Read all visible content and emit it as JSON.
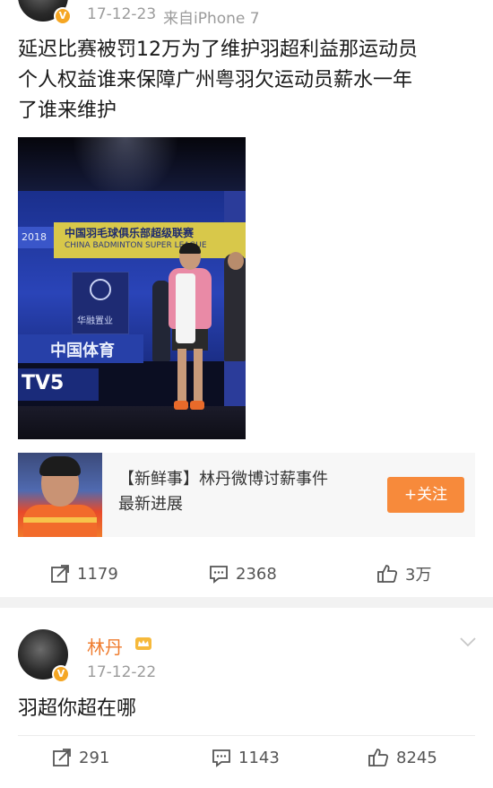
{
  "post1": {
    "timestamp": "17-12-23",
    "source": "来自iPhone 7",
    "text_lines": [
      "延迟比赛被罚12万为了维护羽超利益那运动员",
      "个人权益谁来保障广州粤羽欠运动员薪水一年",
      "了谁来维护"
    ],
    "photo": {
      "banner_cn": "中国羽毛球俱乐部超级联赛",
      "banner_en": "CHINA BADMINTON SUPER LEAGUE",
      "year": "2018",
      "sign": "中国体育",
      "logo_text": "华融置业",
      "tv_text": "TV5"
    },
    "news": {
      "title_line1": "【新鲜事】林丹微博讨薪事件",
      "title_line2": "最新进展",
      "follow_label": "+关注"
    },
    "actions": {
      "repost": "1179",
      "comment": "2368",
      "like": "3万"
    }
  },
  "post2": {
    "author": "林丹",
    "timestamp": "17-12-22",
    "text": "羽超你超在哪",
    "actions": {
      "repost": "291",
      "comment": "1143",
      "like": "8245"
    }
  },
  "colors": {
    "accent": "#f78a3b",
    "name": "#ef7c2e",
    "verified": "#f5a623"
  }
}
